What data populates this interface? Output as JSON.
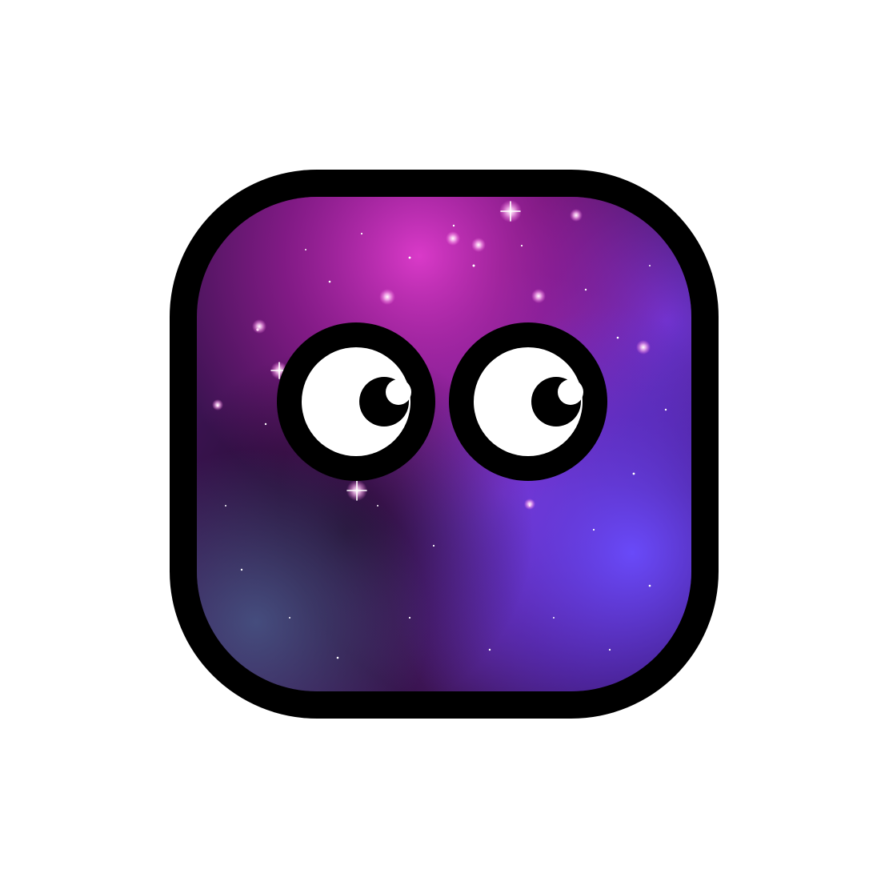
{
  "icon": {
    "name": "googly-eyes-galaxy-app-icon",
    "style": "rounded-square with thick black outline, galaxy nebula fill, two cartoon eyes looking right"
  },
  "colors": {
    "page_background": "#ffffff",
    "outline": "#000000",
    "nebula_magenta": "#c21fb0",
    "nebula_purple": "#7a2bd6",
    "nebula_violet": "#5a3cf0",
    "nebula_deep": "#2a0f3d",
    "nebula_teal_haze": "#3b4a7a",
    "eye_white": "#ffffff",
    "pupil": "#000000",
    "star": "#ffffff"
  }
}
